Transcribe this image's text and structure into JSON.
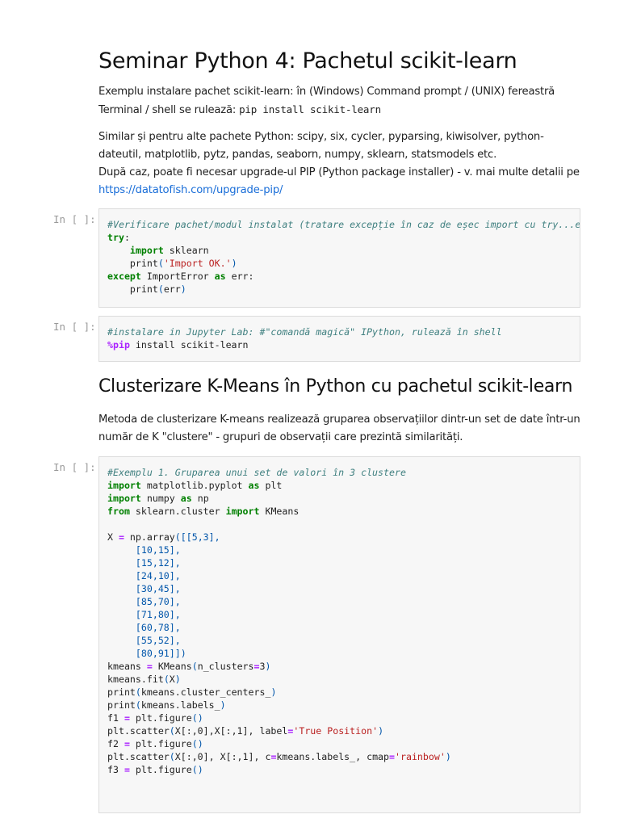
{
  "title": "Seminar Python 4: Pachetul scikit-learn",
  "intro": {
    "text": "Exemplu instalare pachet scikit-learn: în (Windows) Command prompt / (UNIX) fereastră Terminal / shell se rulează: ",
    "cmd": "pip install scikit-learn"
  },
  "para2": {
    "line1": "Similar și pentru alte pachete Python: scipy, six, cycler, pyparsing, kiwisolver, python-dateutil, matplotlib, pytz, pandas, seaborn, numpy, sklearn, statsmodels etc.",
    "line2": "După caz, poate fi necesar upgrade-ul PIP (Python package installer) - v. mai multe detalii pe ",
    "link": "https://datatofish.com/upgrade-pip/"
  },
  "section2": {
    "title": "Clusterizare K-Means în Python cu pachetul scikit-learn",
    "text": "Metoda de clusterizare K-means realizează gruparea observațiilor dintr-un set de date într-un număr de K \"clustere\" - grupuri de observații care prezintă similarități."
  },
  "cells": [
    {
      "prompt": "In [ ]:",
      "lines": [
        [
          [
            "cm",
            "#Verificare pachet/modul instalat (tratare excepție în caz de eșec import cu try...except)"
          ]
        ],
        [
          [
            "kw",
            "try"
          ],
          [
            "tx",
            ":"
          ]
        ],
        [
          [
            "tx",
            "    "
          ],
          [
            "kw",
            "import"
          ],
          [
            "tx",
            " sklearn"
          ]
        ],
        [
          [
            "tx",
            "    print"
          ],
          [
            "pn",
            "("
          ],
          [
            "st",
            "'Import OK.'"
          ],
          [
            "pn",
            ")"
          ]
        ],
        [
          [
            "kw",
            "except"
          ],
          [
            "tx",
            " ImportError "
          ],
          [
            "kw",
            "as"
          ],
          [
            "tx",
            " err:"
          ]
        ],
        [
          [
            "tx",
            "    print"
          ],
          [
            "pn",
            "("
          ],
          [
            "tx",
            "err"
          ],
          [
            "pn",
            ")"
          ]
        ]
      ]
    },
    {
      "prompt": "In [ ]:",
      "lines": [
        [
          [
            "cm",
            "#instalare in Jupyter Lab: #\"comandă magică\" IPython, rulează în shell"
          ]
        ],
        [
          [
            "op",
            "%pip"
          ],
          [
            "tx",
            " install scikit-learn"
          ]
        ]
      ]
    },
    {
      "prompt": "In [ ]:",
      "lines": [
        [
          [
            "cm",
            "#Exemplu 1. Gruparea unui set de valori în 3 clustere"
          ]
        ],
        [
          [
            "kw",
            "import"
          ],
          [
            "tx",
            " matplotlib.pyplot "
          ],
          [
            "kw",
            "as"
          ],
          [
            "tx",
            " plt"
          ]
        ],
        [
          [
            "kw",
            "import"
          ],
          [
            "tx",
            " numpy "
          ],
          [
            "kw",
            "as"
          ],
          [
            "tx",
            " np"
          ]
        ],
        [
          [
            "kw",
            "from"
          ],
          [
            "tx",
            " sklearn.cluster "
          ],
          [
            "kw",
            "import"
          ],
          [
            "tx",
            " KMeans"
          ]
        ],
        [
          [
            "tx",
            ""
          ]
        ],
        [
          [
            "tx",
            "X "
          ],
          [
            "op",
            "="
          ],
          [
            "tx",
            " np.array"
          ],
          [
            "pn",
            "([[5,3],"
          ]
        ],
        [
          [
            "pn",
            "     [10,15],"
          ]
        ],
        [
          [
            "pn",
            "     [15,12],"
          ]
        ],
        [
          [
            "pn",
            "     [24,10],"
          ]
        ],
        [
          [
            "pn",
            "     [30,45],"
          ]
        ],
        [
          [
            "pn",
            "     [85,70],"
          ]
        ],
        [
          [
            "pn",
            "     [71,80],"
          ]
        ],
        [
          [
            "pn",
            "     [60,78],"
          ]
        ],
        [
          [
            "pn",
            "     [55,52],"
          ]
        ],
        [
          [
            "pn",
            "     [80,91]])"
          ]
        ],
        [
          [
            "tx",
            "kmeans "
          ],
          [
            "op",
            "="
          ],
          [
            "tx",
            " KMeans"
          ],
          [
            "pn",
            "("
          ],
          [
            "tx",
            "n_clusters"
          ],
          [
            "op",
            "="
          ],
          [
            "tx",
            "3"
          ],
          [
            "pn",
            ")"
          ]
        ],
        [
          [
            "tx",
            "kmeans.fit"
          ],
          [
            "pn",
            "("
          ],
          [
            "tx",
            "X"
          ],
          [
            "pn",
            ")"
          ]
        ],
        [
          [
            "tx",
            "print"
          ],
          [
            "pn",
            "("
          ],
          [
            "tx",
            "kmeans.cluster_centers_"
          ],
          [
            "pn",
            ")"
          ]
        ],
        [
          [
            "tx",
            "print"
          ],
          [
            "pn",
            "("
          ],
          [
            "tx",
            "kmeans.labels_"
          ],
          [
            "pn",
            ")"
          ]
        ],
        [
          [
            "tx",
            "f1 "
          ],
          [
            "op",
            "="
          ],
          [
            "tx",
            " plt.figure"
          ],
          [
            "pn",
            "()"
          ]
        ],
        [
          [
            "tx",
            "plt.scatter"
          ],
          [
            "pn",
            "("
          ],
          [
            "tx",
            "X[:,0],X[:,1], label"
          ],
          [
            "op",
            "="
          ],
          [
            "st",
            "'True Position'"
          ],
          [
            "pn",
            ")"
          ]
        ],
        [
          [
            "tx",
            "f2 "
          ],
          [
            "op",
            "="
          ],
          [
            "tx",
            " plt.figure"
          ],
          [
            "pn",
            "()"
          ]
        ],
        [
          [
            "tx",
            "plt.scatter"
          ],
          [
            "pn",
            "("
          ],
          [
            "tx",
            "X[:,0], X[:,1], c"
          ],
          [
            "op",
            "="
          ],
          [
            "tx",
            "kmeans.labels_, cmap"
          ],
          [
            "op",
            "="
          ],
          [
            "st",
            "'rainbow'"
          ],
          [
            "pn",
            ")"
          ]
        ],
        [
          [
            "tx",
            "f3 "
          ],
          [
            "op",
            "="
          ],
          [
            "tx",
            " plt.figure"
          ],
          [
            "pn",
            "()"
          ]
        ]
      ]
    }
  ]
}
